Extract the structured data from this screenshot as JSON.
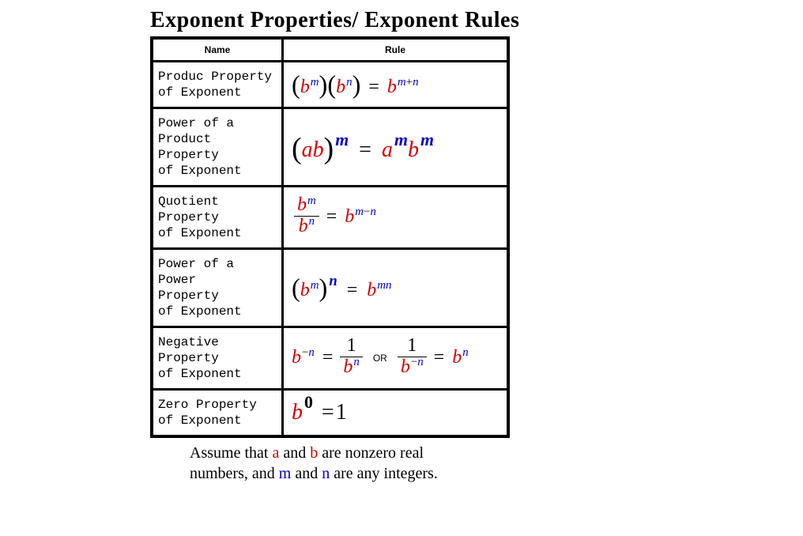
{
  "title": "Exponent Properties/ Exponent Rules",
  "headers": {
    "c0": "Name",
    "c1": "Rule"
  },
  "rows": {
    "r0": {
      "name": "Produc Property\nof Exponent"
    },
    "r1": {
      "name": "Power of a Product\nProperty\nof Exponent"
    },
    "r2": {
      "name": "Quotient Property\nof Exponent"
    },
    "r3": {
      "name": "Power of a Power\nProperty\nof Exponent"
    },
    "r4": {
      "name": "Negative Property\nof Exponent"
    },
    "r5": {
      "name": "Zero Property\nof Exponent"
    }
  },
  "sym": {
    "a": "a",
    "b": "b",
    "m": "m",
    "n": "n",
    "eq": "=",
    "plus": "+",
    "minus": "−",
    "or": "OR",
    "one": "1",
    "zero": "0",
    "lpar": "(",
    "rpar": ")"
  },
  "footer": {
    "p1": "Assume that ",
    "p2": " and ",
    "p3": " are nonzero real",
    "p4": "numbers, and ",
    "p5": " and ",
    "p6": " are any integers."
  },
  "chart_data": {
    "type": "table",
    "title": "Exponent Properties/ Exponent Rules",
    "columns": [
      "Name",
      "Rule"
    ],
    "rows": [
      {
        "name": "Produc Property of Exponent",
        "rule": "(b^m)(b^n) = b^(m+n)"
      },
      {
        "name": "Power of a Product Property of Exponent",
        "rule": "(ab)^m = a^m b^m"
      },
      {
        "name": "Quotient Property of Exponent",
        "rule": "b^m / b^n = b^(m-n)"
      },
      {
        "name": "Power of a Power Property of Exponent",
        "rule": "(b^m)^n = b^(mn)"
      },
      {
        "name": "Negative Property of Exponent",
        "rule": "b^(-n) = 1 / b^n  OR  1 / b^(-n) = b^n"
      },
      {
        "name": "Zero Property of Exponent",
        "rule": "b^0 = 1"
      }
    ],
    "assumption": "Assume that a and b are nonzero real numbers, and m and n are any integers."
  }
}
